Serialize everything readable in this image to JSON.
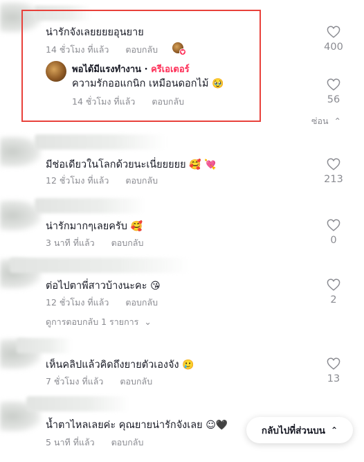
{
  "comments": [
    {
      "text": "น่ารักจังเลยยยยอุนยาย",
      "time": "14 ชั่วโมง ที่แล้ว",
      "reply_label": "ตอบกลับ",
      "likes": "400",
      "creator_liked": true
    },
    {
      "text": "มีช่อเดียวในโลกด้วยนะเนี่ยยยยย",
      "emoji": "🥰 💘",
      "time": "12 ชั่วโมง ที่แล้ว",
      "reply_label": "ตอบกลับ",
      "likes": "213"
    },
    {
      "text": "น่ารักมากๆเลยครับ",
      "emoji": "🥰",
      "time": "3 นาที ที่แล้ว",
      "reply_label": "ตอบกลับ",
      "likes": "0"
    },
    {
      "text": "ต่อไปตาพี่สาวบ้างนะคะ",
      "emoji": "😘",
      "time": "12 ชั่วโมง ที่แล้ว",
      "reply_label": "ตอบกลับ",
      "likes": "2",
      "view_replies": "ดูการตอบกลับ 1 รายการ"
    },
    {
      "text": "เห็นคลิปแล้วคิดถึงยายตัวเองจัง",
      "emoji": "🥲",
      "time": "7 ชั่วโมง ที่แล้ว",
      "reply_label": "ตอบกลับ",
      "likes": "13"
    },
    {
      "text": "น้ำตาไหลเลยค่ะ คุณยายน่ารักจังเลย",
      "emoji": "☺🖤",
      "time": "5 นาที ที่แล้ว",
      "reply_label": "ตอบกลับ"
    }
  ],
  "reply": {
    "author": "พอได้มีแรงทำงาน",
    "separator": "·",
    "creator_label": "ครีเอเตอร์",
    "text": "ความรักออแกนิก เหมือนดอกไม้",
    "emoji": "🥹",
    "time": "14 ชั่วโมง ที่แล้ว",
    "reply_label": "ตอบกลับ",
    "likes": "56"
  },
  "hide_label": "ซ่อน",
  "back_to_top_label": "กลับไปที่ส่วนบน",
  "icons": {
    "like": "heart-outline-icon",
    "hide": "chevron-up-icon",
    "view_replies": "chevron-down-icon",
    "back_to_top": "double-chevron-up-icon"
  },
  "colors": {
    "highlight": "#e8403a",
    "creator": "#fe2c55",
    "muted_text": "#8a8b91"
  }
}
